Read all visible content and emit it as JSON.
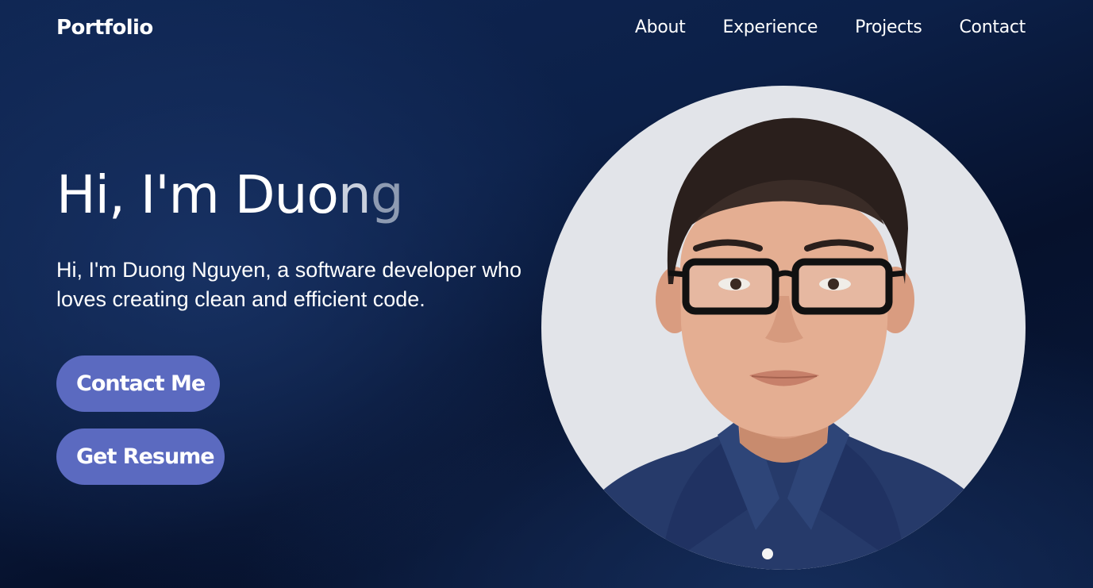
{
  "nav": {
    "logo": "Portfolio",
    "links": [
      "About",
      "Experience",
      "Projects",
      "Contact"
    ]
  },
  "hero": {
    "title_typed": "Hi, I'm Duo",
    "title_fade1": "n",
    "title_fade2": "g",
    "subtitle": "Hi, I'm Duong Nguyen, a software developer who loves creating clean and efficient code.",
    "buttons": {
      "contact": "Contact Me",
      "resume": "Get Resume"
    }
  },
  "colors": {
    "background": "#0a1a3d",
    "button": "#5b6ac0",
    "text": "#ffffff"
  }
}
